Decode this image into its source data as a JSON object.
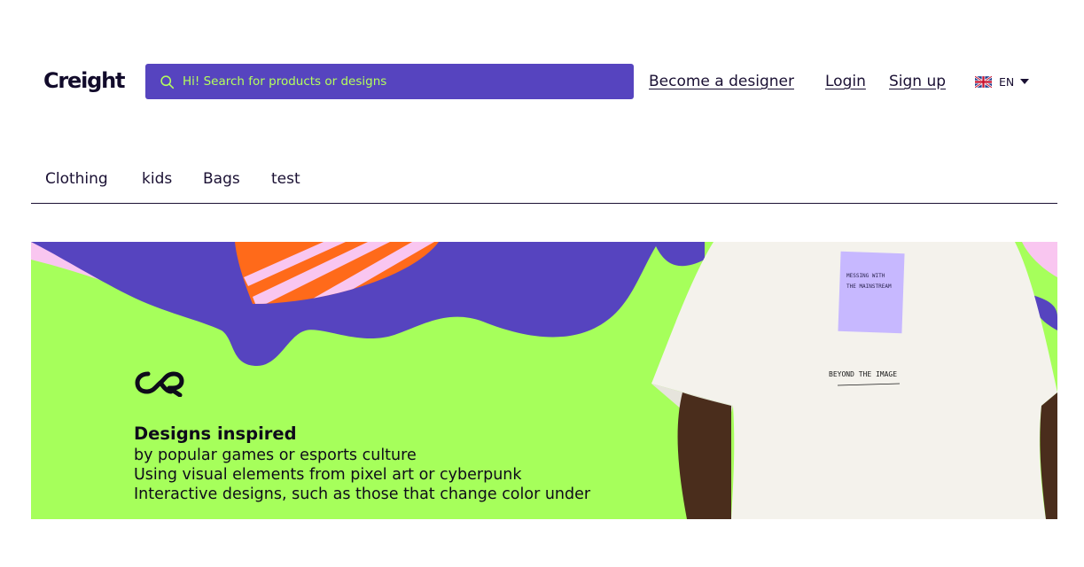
{
  "header": {
    "logo_text": "Creight",
    "search": {
      "placeholder": "Hi! Search for products or designs",
      "value": "",
      "icon": "search-icon"
    },
    "links": {
      "become_designer": "Become a designer",
      "login": "Login",
      "signup": "Sign up"
    },
    "language": {
      "code": "EN",
      "flag_icon": "uk-flag-icon",
      "dropdown_icon": "caret-down-icon"
    }
  },
  "nav": {
    "items": [
      "Clothing",
      "kids",
      "Bags",
      "test"
    ]
  },
  "banner": {
    "title": "Designs inspired",
    "lines": [
      "by popular games or esports culture",
      "Using visual elements from pixel art or cyberpunk",
      "Interactive designs, such as those that change color under"
    ],
    "tshirt_print_text": "MESSING WITH THE MAINSTREAM",
    "tshirt_print_small": "BEYOND THE IMAGE"
  },
  "colors": {
    "brand_purple": "#5644bf",
    "lime": "#a6ff5b",
    "search_text": "#b4ff5c",
    "orange": "#ff6a1a",
    "pink": "#f9c6f0",
    "text_dark": "#1a1033"
  }
}
